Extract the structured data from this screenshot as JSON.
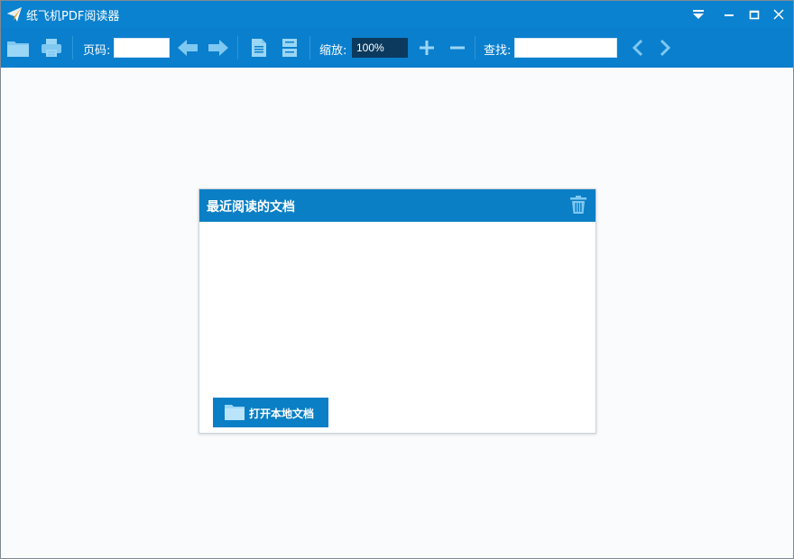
{
  "app": {
    "title": "纸飞机PDF阅读器"
  },
  "toolbar": {
    "page_label": "页码:",
    "page_value": "",
    "zoom_label": "缩放:",
    "zoom_value": "100%",
    "find_label": "查找:",
    "find_value": ""
  },
  "recent_panel": {
    "title": "最近阅读的文档",
    "open_button_label": "打开本地文档"
  },
  "colors": {
    "titlebar": "#0a82cf",
    "toolbar": "#0a7fcd",
    "panel_header": "#0a7fc5",
    "icon_light": "#7fc8f2"
  }
}
